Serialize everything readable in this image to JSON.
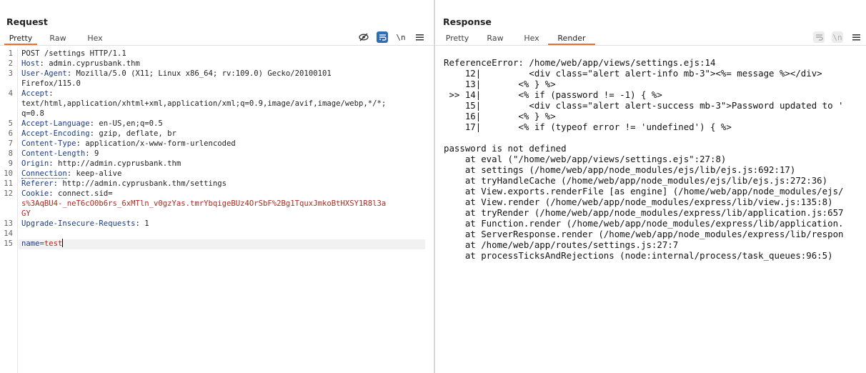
{
  "request": {
    "title": "Request",
    "tabs": [
      "Pretty",
      "Raw",
      "Hex"
    ],
    "toolbar": {
      "hide_icon": "eye-slash-icon",
      "wrap_icon": "wrap-icon",
      "newline_label": "\\n",
      "menu_icon": "menu-icon"
    },
    "lines": [
      {
        "num": "1",
        "name": "",
        "value": "POST /settings HTTP/1.1"
      },
      {
        "num": "2",
        "name": "Host",
        "value": ": admin.cyprusbank.thm"
      },
      {
        "num": "3",
        "name": "User-Agent",
        "value": ": Mozilla/5.0 (X11; Linux x86_64; rv:109.0) Gecko/20100101"
      },
      {
        "num": "",
        "name": "",
        "value": "Firefox/115.0"
      },
      {
        "num": "4",
        "name": "Accept",
        "value": ":"
      },
      {
        "num": "",
        "name": "",
        "value": "text/html,application/xhtml+xml,application/xml;q=0.9,image/avif,image/webp,*/*;"
      },
      {
        "num": "",
        "name": "",
        "value": "q=0.8"
      },
      {
        "num": "5",
        "name": "Accept-Language",
        "value": ": en-US,en;q=0.5"
      },
      {
        "num": "6",
        "name": "Accept-Encoding",
        "value": ": gzip, deflate, br"
      },
      {
        "num": "7",
        "name": "Content-Type",
        "value": ": application/x-www-form-urlencoded"
      },
      {
        "num": "8",
        "name": "Content-Length",
        "value": ": 9"
      },
      {
        "num": "9",
        "name": "Origin",
        "value": ": http://admin.cyprusbank.thm"
      },
      {
        "num": "10",
        "name": "Connection",
        "value": ": keep-alive"
      },
      {
        "num": "11",
        "name": "Referer",
        "value": ": http://admin.cyprusbank.thm/settings"
      },
      {
        "num": "12",
        "name": "Cookie",
        "value": ": connect.sid="
      },
      {
        "num": "",
        "name": "",
        "value": "s%3AqBU4-_neT6cO0b6rs_6xMTln_v0gzYas.tmrYbqigeBUz4OrSbF%2Bg1TquxJmkoBtHXSY1R8l3a"
      },
      {
        "num": "",
        "name": "",
        "value": "GY"
      },
      {
        "num": "13",
        "name": "Upgrade-Insecure-Requests",
        "value": ": 1"
      },
      {
        "num": "14",
        "name": "",
        "value": ""
      },
      {
        "num": "15",
        "name": "name",
        "value": "=test"
      }
    ]
  },
  "response": {
    "title": "Response",
    "tabs": [
      "Pretty",
      "Raw",
      "Hex",
      "Render"
    ],
    "toolbar": {
      "wrap_icon": "wrap-icon",
      "newline_label": "\\n",
      "menu_icon": "menu-icon"
    },
    "layout_icons": [
      "side-by-side-icon",
      "stacked-icon",
      "single-pane-icon"
    ],
    "text": [
      "ReferenceError: /home/web/app/views/settings.ejs:14",
      "    12|         <div class=\"alert alert-info mb-3\"><%= message %></div>",
      "    13|       <% } %>",
      " >> 14|       <% if (password != -1) { %>",
      "    15|         <div class=\"alert alert-success mb-3\">Password updated to '",
      "    16|       <% } %>",
      "    17|       <% if (typeof error != 'undefined') { %>",
      "",
      "password is not defined",
      "    at eval (\"/home/web/app/views/settings.ejs\":27:8)",
      "    at settings (/home/web/app/node_modules/ejs/lib/ejs.js:692:17)",
      "    at tryHandleCache (/home/web/app/node_modules/ejs/lib/ejs.js:272:36)",
      "    at View.exports.renderFile [as engine] (/home/web/app/node_modules/ejs/",
      "    at View.render (/home/web/app/node_modules/express/lib/view.js:135:8)",
      "    at tryRender (/home/web/app/node_modules/express/lib/application.js:657",
      "    at Function.render (/home/web/app/node_modules/express/lib/application.",
      "    at ServerResponse.render (/home/web/app/node_modules/express/lib/respon",
      "    at /home/web/app/routes/settings.js:27:7",
      "    at processTicksAndRejections (node:internal/process/task_queues:96:5)"
    ]
  }
}
